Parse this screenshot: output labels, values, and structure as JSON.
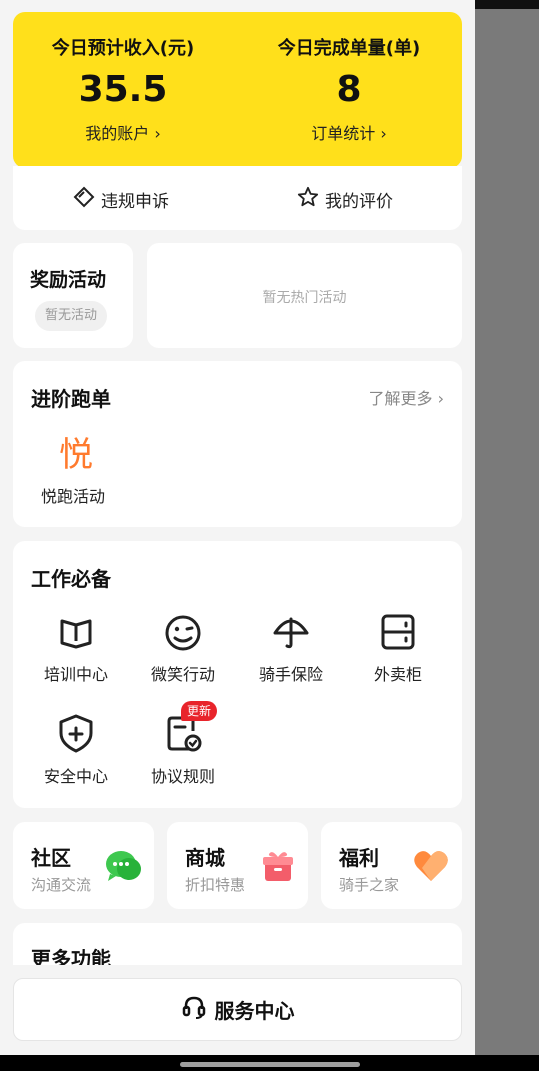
{
  "income": {
    "label": "今日预计收入(元)",
    "value": "35.5",
    "link": "我的账户"
  },
  "orders": {
    "label": "今日完成单量(单)",
    "value": "8",
    "link": "订单统计"
  },
  "quick_links": {
    "appeal": "违规申诉",
    "review": "我的评价"
  },
  "reward": {
    "title": "奖励活动",
    "empty": "暂无活动"
  },
  "hot": {
    "empty": "暂无热门活动"
  },
  "advanced": {
    "title": "进阶跑单",
    "more": "了解更多",
    "item_icon": "悦",
    "item_label": "悦跑活动"
  },
  "work": {
    "title": "工作必备",
    "items": [
      "培训中心",
      "微笑行动",
      "骑手保险",
      "外卖柜",
      "安全中心",
      "协议规则"
    ],
    "badge": "更新"
  },
  "community": {
    "title": "社区",
    "sub": "沟通交流"
  },
  "mall": {
    "title": "商城",
    "sub": "折扣特惠"
  },
  "welfare": {
    "title": "福利",
    "sub": "骑手之家"
  },
  "more_functions": {
    "title": "更多功能"
  },
  "service": {
    "label": "服务中心"
  },
  "colors": {
    "accent_yellow": "#ffe01b",
    "orange": "#ff7a2d",
    "green": "#3ec84f",
    "red_badge": "#e8242b"
  }
}
